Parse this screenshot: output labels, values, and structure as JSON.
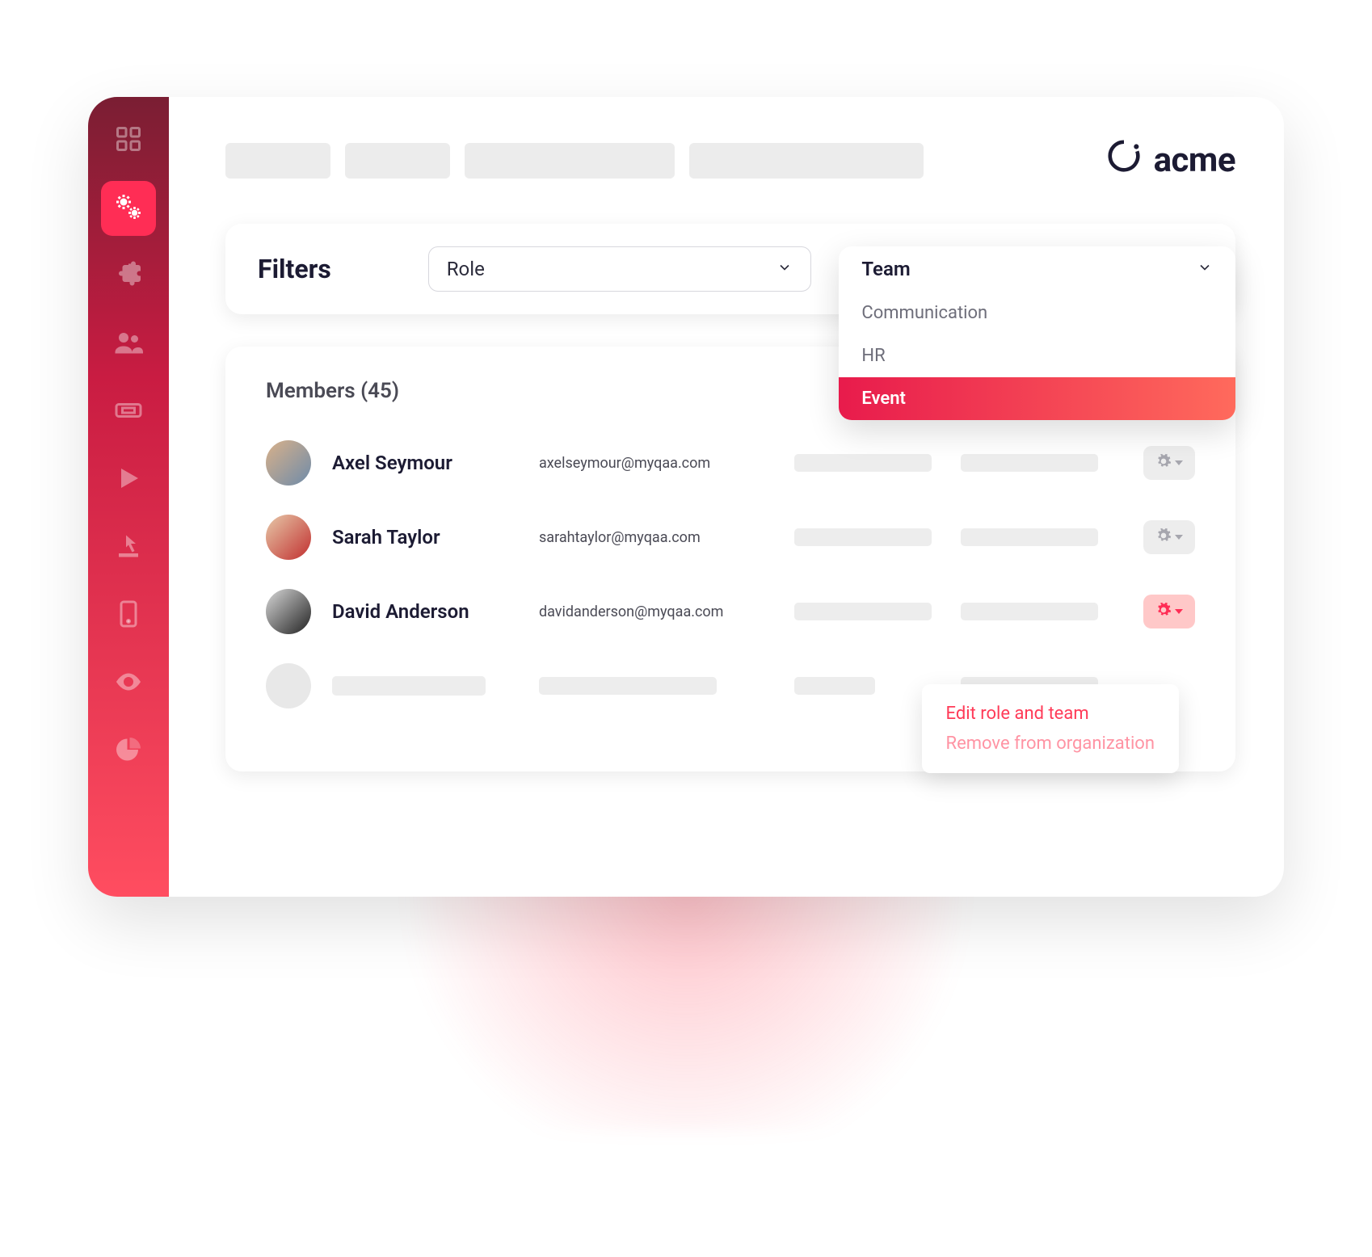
{
  "brand": {
    "name": "acme"
  },
  "filters": {
    "label": "Filters",
    "role_label": "Role",
    "team_label": "Team",
    "team_options": [
      "Communication",
      "HR",
      "Event"
    ],
    "team_selected": "Event"
  },
  "members": {
    "title": "Members (45)",
    "rows": [
      {
        "name": "Axel Seymour",
        "email": "axelseymour@myqaa.com"
      },
      {
        "name": "Sarah Taylor",
        "email": "sarahtaylor@myqaa.com"
      },
      {
        "name": "David Anderson",
        "email": "davidanderson@myqaa.com"
      }
    ]
  },
  "action_menu": {
    "edit": "Edit role and team",
    "remove": "Remove from organization"
  }
}
